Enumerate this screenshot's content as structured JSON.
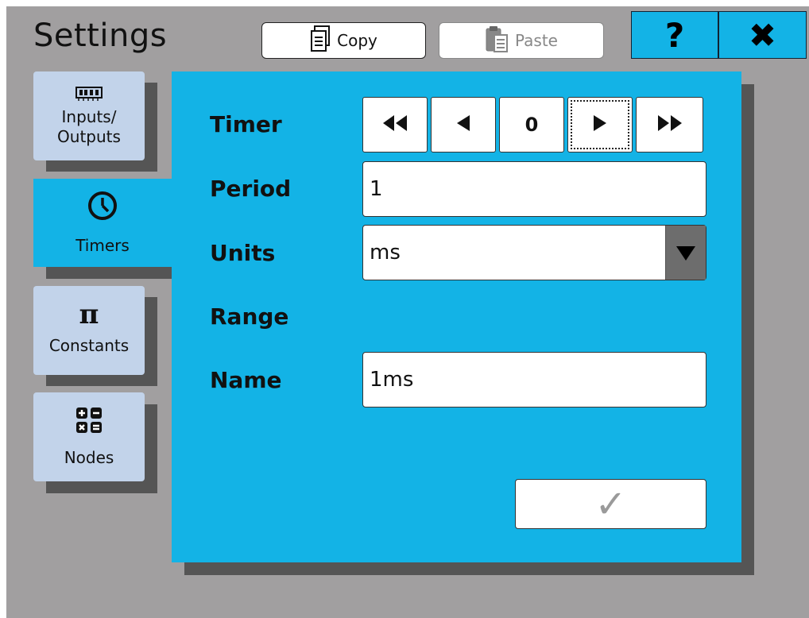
{
  "header": {
    "title": "Settings",
    "copy_label": "Copy",
    "paste_label": "Paste",
    "help_glyph": "?",
    "close_glyph": "✖"
  },
  "tabs": [
    {
      "label_line1": "Inputs/",
      "label_line2": "Outputs",
      "icon": "memory-chip-icon"
    },
    {
      "label": "Timers",
      "icon": "clock-icon",
      "active": true
    },
    {
      "label": "Constants",
      "icon": "pi-icon"
    },
    {
      "label": "Nodes",
      "icon": "calculator-icon"
    }
  ],
  "form": {
    "timer_label": "Timer",
    "period_label": "Period",
    "units_label": "Units",
    "range_label": "Range",
    "name_label": "Name",
    "timer_value": "0",
    "period_value": "1",
    "units_value": "ms",
    "name_value": "1ms",
    "confirm_glyph": "✓"
  },
  "colors": {
    "accent": "#13b3e6",
    "background": "#a19fa0",
    "tab_inactive": "#c2d3ea"
  }
}
